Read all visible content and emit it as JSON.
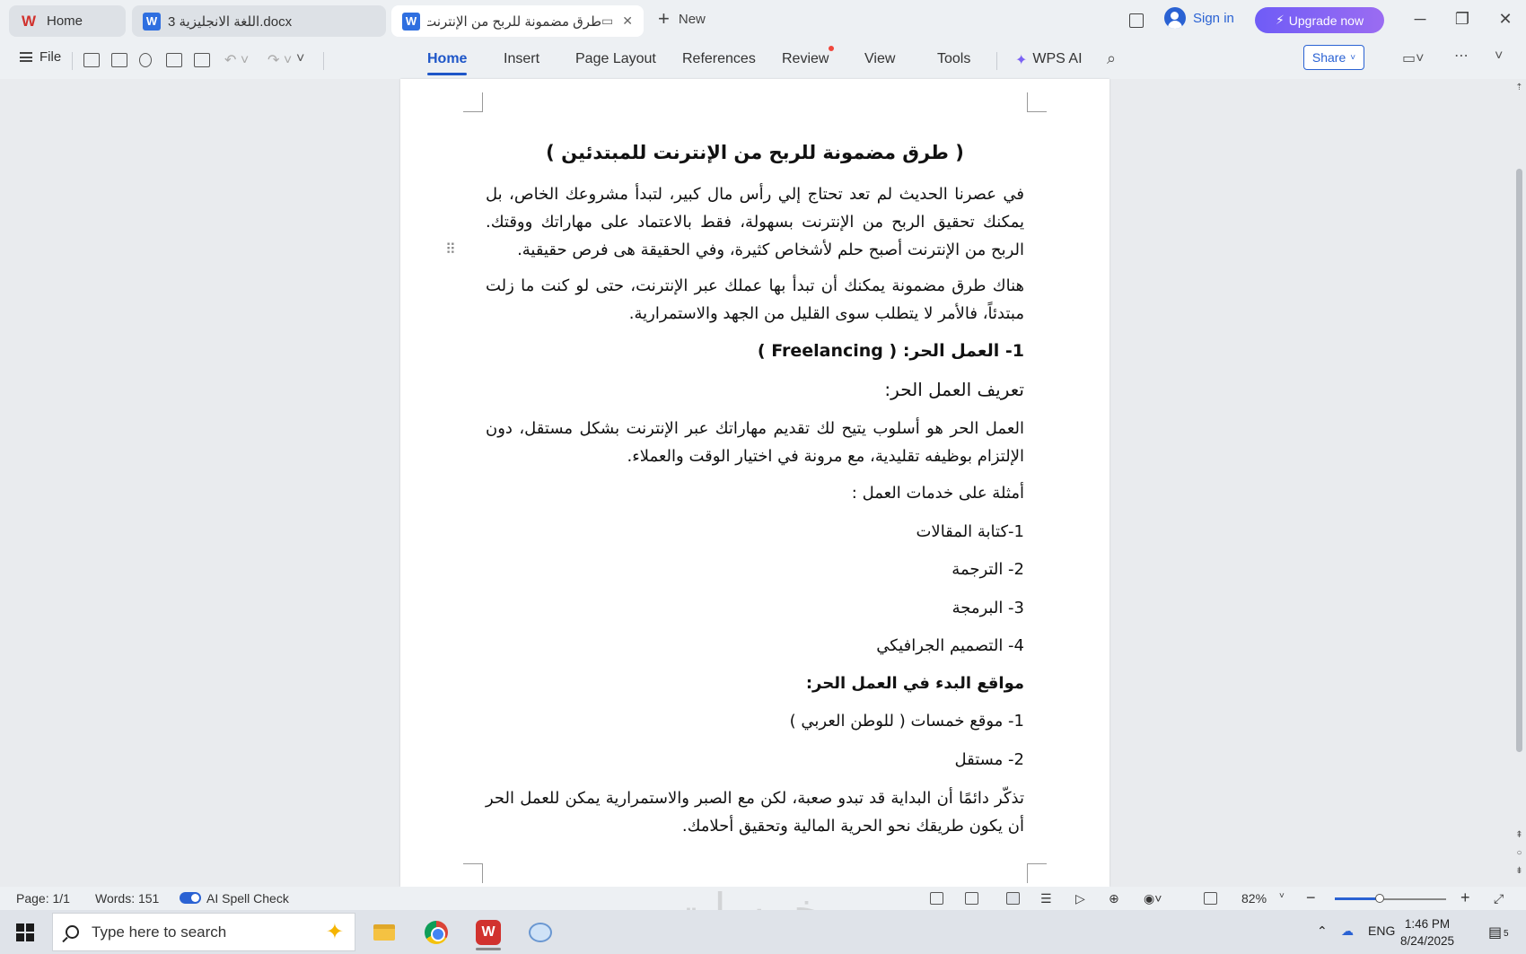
{
  "tabs": [
    {
      "label": "Home"
    },
    {
      "label": "اللغة الانجليزية 3.docx"
    },
    {
      "label": "طرق مضمونة للربح من الإنترنت للمبتدئين"
    }
  ],
  "new_tab_label": "New",
  "sign_in": "Sign in",
  "upgrade": "Upgrade now",
  "file_menu": "File",
  "ribbon": [
    "Home",
    "Insert",
    "Page Layout",
    "References",
    "Review",
    "View",
    "Tools",
    "WPS AI"
  ],
  "share": "Share",
  "document": {
    "title": "( طرق مضمونة للربح من الإنترنت للمبتدئين )",
    "intro": "في عصرنا الحديث لم تعد تحتاج إلي رأس مال كبير، لتبدأ مشروعك الخاص، بل يمكنك تحقيق الربح من الإنترنت بسهولة، فقط بالاعتماد على مهاراتك ووقتك. الربح من الإنترنت أصبح حلم لأشخاص كثيرة، وفي الحقيقة هى فرص حقيقية.",
    "intro2": "هناك طرق مضمونة يمكنك أن تبدأ بها عملك عبر الإنترنت، حتى لو كنت ما زلت مبتدئاً، فالأمر لا يتطلب سوى القليل من الجهد والاستمرارية.",
    "section1": "1-  العمل الحر: ( Freelancing )",
    "def_heading": "تعريف العمل الحر:",
    "def_text": "العمل الحر هو أسلوب يتيح لك تقديم مهاراتك عبر الإنترنت بشكل مستقل، دون الإلتزام بوظيفه تقليدية، مع مرونة في اختيار الوقت والعملاء.",
    "examples_heading": "أمثلة على خدمات العمل :",
    "examples": [
      "1-كتابة المقالات",
      "2- الترجمة",
      "3- البرمجة",
      "4- التصميم الجرافيكي"
    ],
    "sites_heading": "مواقع البدء في العمل الحر:",
    "sites": [
      "1- موقع خمسات ( للوطن العربي )",
      "2- مستقل"
    ],
    "closing": "تذكّر دائمًا أن البداية قد تبدو صعبة، لكن مع الصبر والاستمرارية يمكن للعمل الحر أن يكون طريقك نحو الحرية المالية وتحقيق أحلامك."
  },
  "status": {
    "page": "Page: 1/1",
    "words": "Words: 151",
    "spell": "AI Spell Check",
    "zoom": "82%",
    "zoom_level": 0.4
  },
  "taskbar": {
    "search_placeholder": "Type here to search",
    "lang": "ENG",
    "time": "1:46 PM",
    "date": "8/24/2025",
    "notifications": "5"
  },
  "watermark": "خمسات",
  "colors": {
    "accent": "#1e56c8",
    "upgrade": "#7b62f4",
    "wps_red": "#d1322e"
  }
}
